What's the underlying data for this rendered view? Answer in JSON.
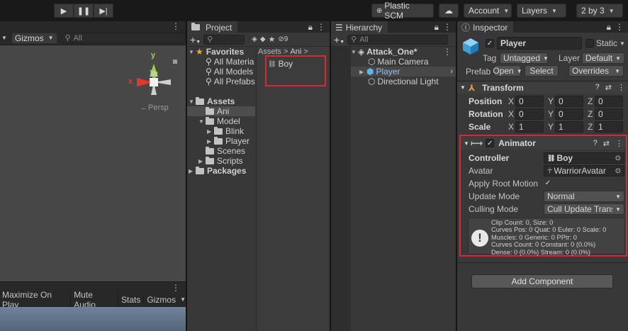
{
  "toolbar": {
    "play_icon": "play-icon",
    "pause_icon": "pause-icon",
    "step_icon": "step-icon",
    "plastic_scm_label": "Plastic SCM",
    "account_label": "Account",
    "layers_label": "Layers",
    "layout_label": "2 by 3"
  },
  "scene": {
    "gizmos_label": "Gizmos",
    "search_placeholder": "All",
    "gizmo_axes": {
      "x": "x",
      "y": "y"
    },
    "persp_label": "←Persp"
  },
  "game": {
    "maximize_label": "Maximize On Play",
    "mute_label": "Mute Audio",
    "stats_label": "Stats",
    "gizmos_label": "Gizmos"
  },
  "project": {
    "tab_label": "Project",
    "add_label": "+",
    "hidden_count": "9",
    "favorites_label": "Favorites",
    "favorites": [
      "All Materia",
      "All Models",
      "All Prefabs"
    ],
    "assets_label": "Assets",
    "tree": [
      "Ani",
      "Model",
      "Blink",
      "Player",
      "Scenes",
      "Scripts"
    ],
    "packages_label": "Packages",
    "breadcrumb": [
      "Assets",
      "Ani"
    ],
    "files": [
      "Boy"
    ]
  },
  "hierarchy": {
    "tab_label": "Hierarchy",
    "add_label": "+",
    "search_placeholder": "All",
    "scene_name": "Attack_One*",
    "items": [
      "Main Camera",
      "Player",
      "Directional Light"
    ]
  },
  "inspector": {
    "tab_label": "Inspector",
    "object_name": "Player",
    "static_label": "Static",
    "tag_label": "Tag",
    "tag_value": "Untagged",
    "layer_label": "Layer",
    "layer_value": "Default",
    "prefab_label": "Prefab",
    "open_label": "Open",
    "select_label": "Select",
    "overrides_label": "Overrides",
    "transform": {
      "title": "Transform",
      "rows": [
        {
          "label": "Position",
          "x": "0",
          "y": "0",
          "z": "0"
        },
        {
          "label": "Rotation",
          "x": "0",
          "y": "0",
          "z": "0"
        },
        {
          "label": "Scale",
          "x": "1",
          "y": "1",
          "z": "1"
        }
      ]
    },
    "animator": {
      "title": "Animator",
      "controller_label": "Controller",
      "controller_value": "Boy",
      "avatar_label": "Avatar",
      "avatar_value": "WarriorAvatar",
      "root_motion_label": "Apply Root Motion",
      "update_mode_label": "Update Mode",
      "update_mode_value": "Normal",
      "culling_mode_label": "Culling Mode",
      "culling_mode_value": "Cull Update Transf",
      "info": [
        "Clip Count: 0, Size: 0",
        "Curves Pos: 0 Quat: 0 Euler: 0 Scale: 0",
        "Muscles: 0 Generic: 0 PPtr: 0",
        "Curves Count: 0 Constant: 0 (0.0%)",
        "Dense: 0 (0.0%) Stream: 0 (0.0%)"
      ]
    },
    "add_component_label": "Add Component"
  }
}
